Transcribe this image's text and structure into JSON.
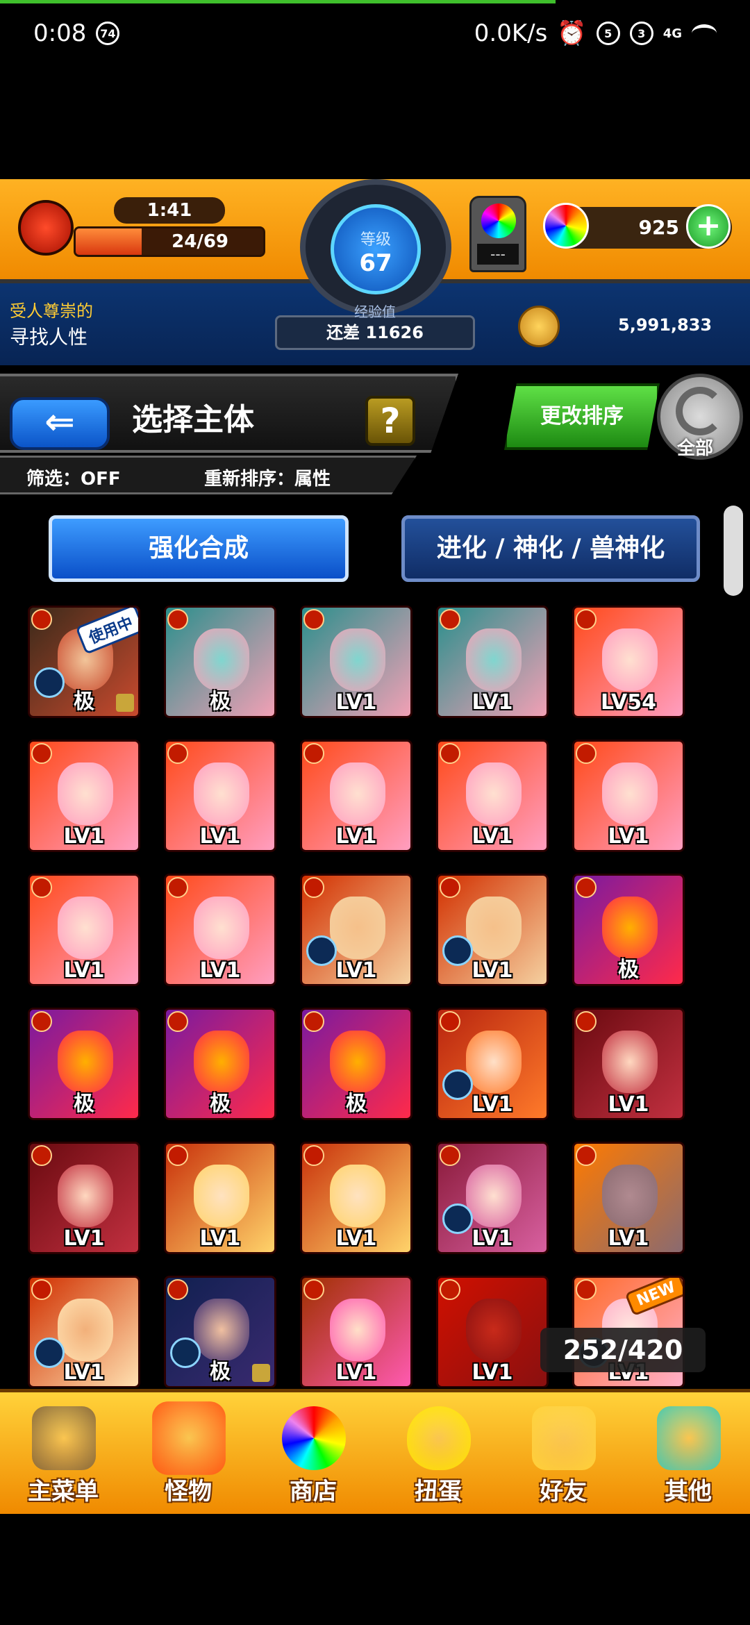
{
  "status_bar": {
    "time": "0:08",
    "notif_badge": "74",
    "net_speed": "0.0K/s",
    "sim1": "5",
    "sim2": "3",
    "network": "4G"
  },
  "hud": {
    "stamina_timer": "1:41",
    "stamina": "24/69",
    "stamina_fraction": 0.35,
    "rank_label": "等级",
    "rank_value": "67",
    "exp_label": "经验值",
    "exp_remaining": "还差 11626",
    "title_line1": "受人尊崇的",
    "title_line2": "寻找人性",
    "capsule_text": "---",
    "orb_count": "925",
    "plus_symbol": "+",
    "coin_count": "5,991,833",
    "colors": {
      "hud_orange": "#f49a10",
      "hud_blue": "#082454",
      "rank_blue": "#0b4fb5"
    }
  },
  "header": {
    "back_symbol": "⇐",
    "title": "选择主体",
    "help_symbol": "?",
    "filter_label": "筛选：OFF",
    "sort_label": "重新排序：属性",
    "change_sort_label": "更改排序",
    "all_label": "全部"
  },
  "tabs": {
    "fusion": "强化合成",
    "evolve": "进化 / 神化 / 兽神化"
  },
  "monsters": [
    {
      "label": "极",
      "art": "red-witch",
      "badge": "使用中",
      "lock": true,
      "sub": true
    },
    {
      "label": "极",
      "art": "teal-hair",
      "badge": "",
      "lock": false,
      "sub": false
    },
    {
      "label": "LV1",
      "art": "teal-hair",
      "badge": "",
      "lock": false,
      "sub": false
    },
    {
      "label": "LV1",
      "art": "teal-hair",
      "badge": "",
      "lock": false,
      "sub": false
    },
    {
      "label": "LV54",
      "art": "pink-hair",
      "badge": "",
      "lock": false,
      "sub": false
    },
    {
      "label": "LV1",
      "art": "pink-hair",
      "badge": "",
      "lock": false,
      "sub": false
    },
    {
      "label": "LV1",
      "art": "pink-hair",
      "badge": "",
      "lock": false,
      "sub": false
    },
    {
      "label": "LV1",
      "art": "pink-hair",
      "badge": "",
      "lock": false,
      "sub": false
    },
    {
      "label": "LV1",
      "art": "pink-hair",
      "badge": "",
      "lock": false,
      "sub": false
    },
    {
      "label": "LV1",
      "art": "pink-hair",
      "badge": "",
      "lock": false,
      "sub": false
    },
    {
      "label": "LV1",
      "art": "pink-hair",
      "badge": "",
      "lock": false,
      "sub": false
    },
    {
      "label": "LV1",
      "art": "pink-hair",
      "badge": "",
      "lock": false,
      "sub": false
    },
    {
      "label": "LV1",
      "art": "monk",
      "badge": "",
      "lock": false,
      "sub": true
    },
    {
      "label": "LV1",
      "art": "monk",
      "badge": "",
      "lock": false,
      "sub": true
    },
    {
      "label": "极",
      "art": "fire-orb",
      "badge": "",
      "lock": false,
      "sub": false
    },
    {
      "label": "极",
      "art": "fire-orb",
      "badge": "",
      "lock": false,
      "sub": false
    },
    {
      "label": "极",
      "art": "fire-orb",
      "badge": "",
      "lock": false,
      "sub": false
    },
    {
      "label": "极",
      "art": "fire-orb",
      "badge": "",
      "lock": false,
      "sub": false
    },
    {
      "label": "LV1",
      "art": "orange-girl",
      "badge": "",
      "lock": false,
      "sub": true
    },
    {
      "label": "LV1",
      "art": "red-hair",
      "badge": "",
      "lock": false,
      "sub": false
    },
    {
      "label": "LV1",
      "art": "red-hair",
      "badge": "",
      "lock": false,
      "sub": false
    },
    {
      "label": "LV1",
      "art": "laurel-blonde",
      "badge": "",
      "lock": false,
      "sub": false
    },
    {
      "label": "LV1",
      "art": "laurel-blonde",
      "badge": "",
      "lock": false,
      "sub": false
    },
    {
      "label": "LV1",
      "art": "sunglasses-girl",
      "badge": "",
      "lock": false,
      "sub": true
    },
    {
      "label": "LV1",
      "art": "frankenstein",
      "badge": "",
      "lock": false,
      "sub": false
    },
    {
      "label": "LV1",
      "art": "big-man",
      "badge": "",
      "lock": false,
      "sub": true
    },
    {
      "label": "极",
      "art": "dark-hair",
      "badge": "",
      "lock": true,
      "sub": true
    },
    {
      "label": "LV1",
      "art": "princess",
      "badge": "",
      "lock": false,
      "sub": false
    },
    {
      "label": "LV1",
      "art": "demon",
      "badge": "",
      "lock": false,
      "sub": false
    },
    {
      "label": "LV1",
      "art": "pink-new",
      "badge": "NEW",
      "lock": false,
      "sub": true
    }
  ],
  "box_count": "252/420",
  "nav": [
    {
      "label": "主菜单",
      "icon": "gate-icon",
      "color": "#8a6a3a",
      "active": false
    },
    {
      "label": "怪物",
      "icon": "monster-icon",
      "color": "#ff5a14",
      "active": true
    },
    {
      "label": "商店",
      "icon": "orb-shop-icon",
      "color": "#7ad8ff",
      "active": false
    },
    {
      "label": "扭蛋",
      "icon": "egg-icon",
      "color": "#ffe600",
      "active": false
    },
    {
      "label": "好友",
      "icon": "friends-icon",
      "color": "#ffd23a",
      "active": false
    },
    {
      "label": "其他",
      "icon": "other-icon",
      "color": "#47c9b0",
      "active": false
    }
  ]
}
